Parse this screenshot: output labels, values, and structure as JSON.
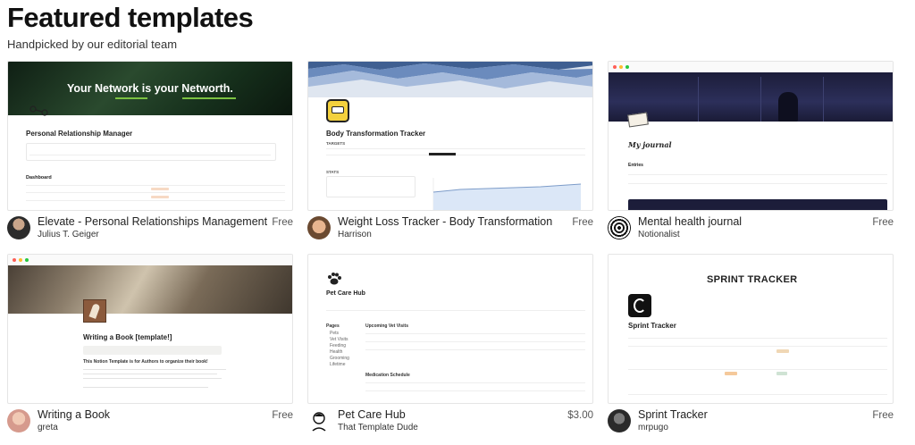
{
  "header": {
    "title": "Featured templates",
    "subtitle": "Handpicked by our editorial team"
  },
  "templates": [
    {
      "name": "Elevate - Personal Relationships Management",
      "author": "Julius T. Geiger",
      "price": "Free",
      "preview": {
        "banner_text": "Your Network is your Networth.",
        "page_title": "Personal Relationship Manager",
        "section": "Dashboard"
      }
    },
    {
      "name": "Weight Loss Tracker - Body Transformation",
      "author": "Harrison",
      "price": "Free",
      "preview": {
        "page_title": "Body Transformation Tracker",
        "targets_label": "TARGETS",
        "stats_label": "STATS"
      }
    },
    {
      "name": "Mental health journal",
      "author": "Notionalist",
      "price": "Free",
      "preview": {
        "page_title": "My journal",
        "entries_label": "Entries"
      }
    },
    {
      "name": "Writing a Book",
      "author": "greta",
      "price": "Free",
      "preview": {
        "page_title": "Writing a Book [template!]",
        "body": "This Notion Template is for Authors to organize their book!"
      }
    },
    {
      "name": "Pet Care Hub",
      "author": "That Template Dude",
      "price": "$3.00",
      "preview": {
        "page_title": "Pet Care Hub",
        "vet_visits": "Upcoming Vet Visits",
        "medication": "Medication Schedule",
        "pages": [
          "Pets",
          "Vet Visits",
          "Feeding",
          "Health",
          "Grooming",
          "Lifetime"
        ]
      }
    },
    {
      "name": "Sprint Tracker",
      "author": "mrpugo",
      "price": "Free",
      "preview": {
        "banner_text": "SPRINT TRACKER",
        "page_title": "Sprint Tracker"
      }
    }
  ],
  "colors": {
    "price_text": "#555555",
    "thumb_border": "#e5e5e5",
    "green_underline": "#7cc242",
    "sky_blue": "#7d9cc9"
  }
}
